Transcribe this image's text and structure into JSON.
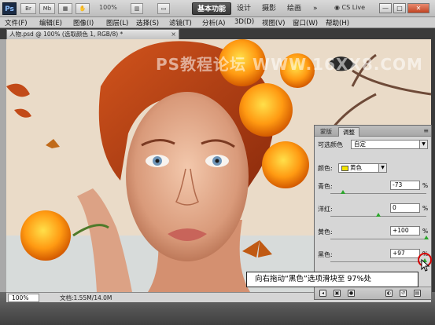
{
  "app": {
    "logo": "Ps",
    "toolbar": {
      "br_label": "Br",
      "mb_label": "Mb",
      "zoom": "100%",
      "workspaces": [
        "基本功能",
        "设计",
        "摄影",
        "绘画"
      ],
      "more": "»",
      "cs_live": "CS Live"
    },
    "window_controls": [
      "—",
      "□",
      "✕"
    ]
  },
  "menu": [
    "文件(F)",
    "编辑(E)",
    "图像(I)",
    "图层(L)",
    "选择(S)",
    "滤镜(T)",
    "分析(A)",
    "3D(D)",
    "视图(V)",
    "窗口(W)",
    "帮助(H)"
  ],
  "document": {
    "tab_title": "人物.psd @ 100% (选取颜色 1, RGB/8) *",
    "tab_close": "×",
    "watermark": "PS教程论坛 WWW.16XX8.COM"
  },
  "status": {
    "zoom": "100%",
    "doc_info": "文档:1.55M/14.0M"
  },
  "panel": {
    "tabs": [
      "蒙版",
      "调整"
    ],
    "active_tab": 1,
    "menu_icon": "≡",
    "title": "可选颜色",
    "preset": "自定",
    "color_label": "颜色:",
    "color_value": "黄色",
    "percent": "%",
    "sliders": [
      {
        "label": "青色:",
        "value": "-73",
        "level": -73
      },
      {
        "label": "洋红:",
        "value": "0",
        "level": 0
      },
      {
        "label": "黄色:",
        "value": "+100",
        "level": 100
      },
      {
        "label": "黑色:",
        "value": "+97",
        "level": 97
      }
    ],
    "footer_icons": [
      "back-icon",
      "layer-icon",
      "eye-icon",
      "view-icon",
      "reset-icon",
      "delete-icon"
    ]
  },
  "annotation": {
    "text": "向右拖动“黑色”选项滑块至 97%处"
  },
  "colors": {
    "accent": "#2aa62a",
    "highlight": "#d40000",
    "swatch": "#f3e400"
  }
}
